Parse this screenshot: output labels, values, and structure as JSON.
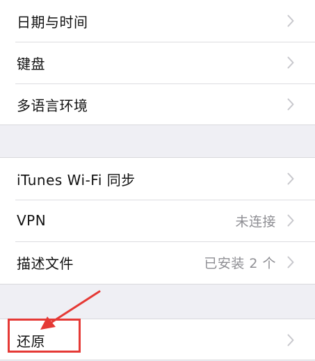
{
  "settings": {
    "group1": [
      {
        "label": "日期与时间"
      },
      {
        "label": "键盘"
      },
      {
        "label": "多语言环境"
      }
    ],
    "group2": [
      {
        "label": "iTunes Wi-Fi 同步",
        "detail": ""
      },
      {
        "label": "VPN",
        "detail": "未连接"
      },
      {
        "label": "描述文件",
        "detail": "已安装 2 个"
      }
    ],
    "group3": [
      {
        "label": "还原"
      }
    ]
  },
  "colors": {
    "background": "#efeff4",
    "cell": "#ffffff",
    "separator": "#dcdce0",
    "detail_text": "#8e8e93",
    "chevron": "#c7c7cc",
    "annotation": "#e53935"
  },
  "icons": {
    "chevron": "chevron-right-icon",
    "annotation_arrow": "arrow-icon"
  }
}
